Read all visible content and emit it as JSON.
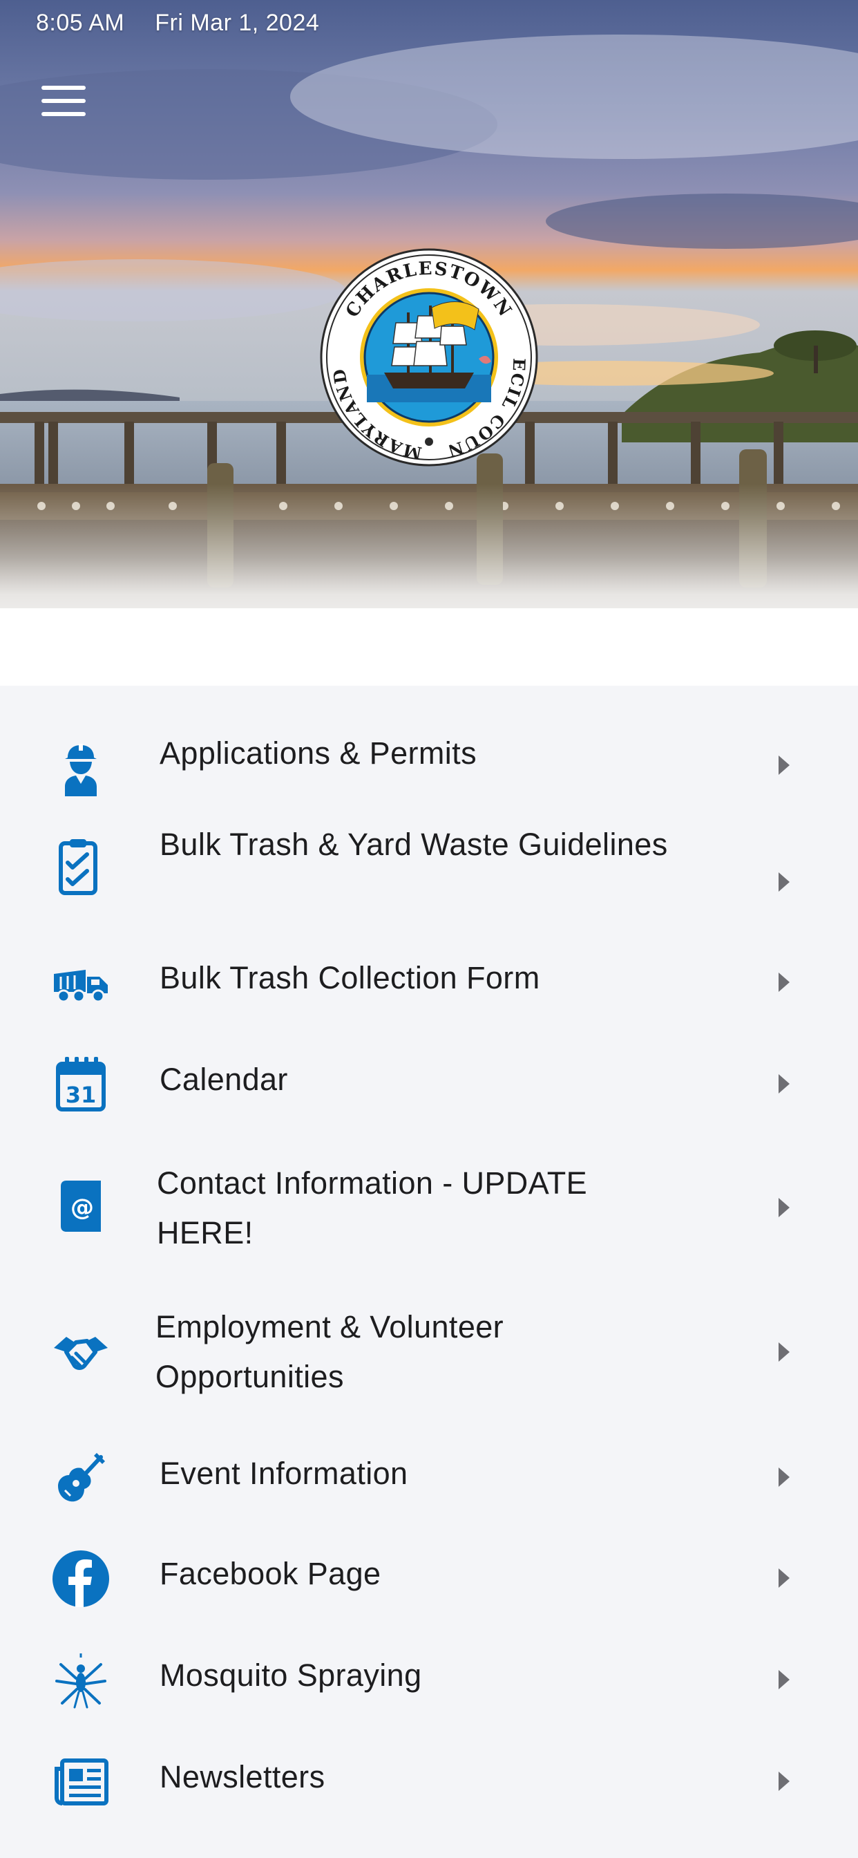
{
  "status_bar": {
    "time": "8:05 AM",
    "date": "Fri Mar 1, 2024"
  },
  "header": {
    "menu_icon": "hamburger-menu-icon",
    "seal": {
      "top_text": "CHARLESTOWN",
      "left_text": "MARYLAND",
      "right_text": "CECIL COUNTY",
      "icon": "ship-seal-logo"
    }
  },
  "colors": {
    "accent": "#0a72c0",
    "text": "#1d1d1f",
    "background": "#f4f5f8",
    "chevron": "#6e6e73"
  },
  "menu_items": [
    {
      "label": "Applications & Permits",
      "icon": "worker-icon"
    },
    {
      "label": "Bulk Trash & Yard Waste Guidelines",
      "icon": "clipboard-check-icon"
    },
    {
      "label": "Bulk Trash Collection Form",
      "icon": "dump-truck-icon"
    },
    {
      "label": "Calendar",
      "icon": "calendar-icon"
    },
    {
      "label": "Contact Information - UPDATE HERE!",
      "icon": "address-book-icon"
    },
    {
      "label": "Employment & Volunteer Opportunities",
      "icon": "handshake-icon"
    },
    {
      "label": "Event Information",
      "icon": "guitar-icon"
    },
    {
      "label": "Facebook Page",
      "icon": "facebook-icon"
    },
    {
      "label": "Mosquito Spraying",
      "icon": "mosquito-icon"
    },
    {
      "label": "Newsletters",
      "icon": "newspaper-icon"
    }
  ]
}
